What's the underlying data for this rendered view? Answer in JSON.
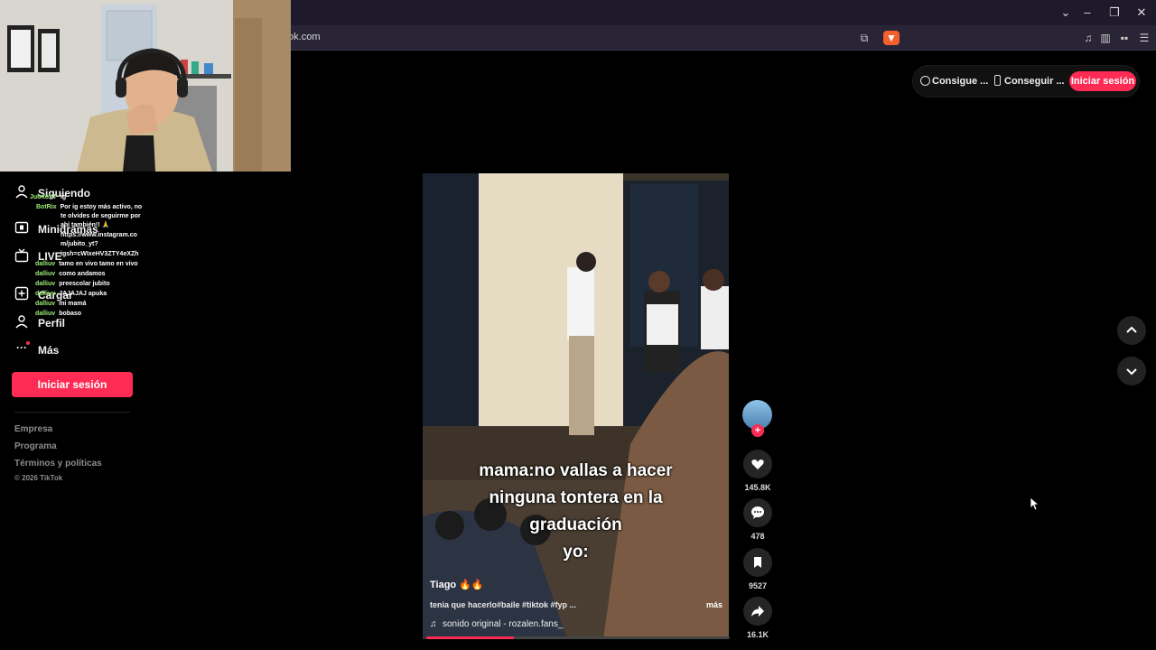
{
  "browser": {
    "url": "tok.com"
  },
  "top_actions": {
    "coins_label": "Consigue ...",
    "app_label": "Conseguir ...",
    "login_label": "Iniciar sesión"
  },
  "sidebar": {
    "items": [
      {
        "label": "Siguiendo",
        "icon": "user-icon"
      },
      {
        "label": "Minidramas",
        "icon": "film-icon"
      },
      {
        "label": "LIVE",
        "icon": "tv-icon"
      },
      {
        "label": "Cargar",
        "icon": "plus-square-icon"
      },
      {
        "label": "Perfil",
        "icon": "person-icon"
      },
      {
        "label": "Más",
        "icon": "dots-icon"
      }
    ],
    "login_label": "Iniciar sesión",
    "footer": {
      "company": "Empresa",
      "program": "Programa",
      "terms": "Términos y políticas",
      "copyright": "© 2026 TikTok"
    }
  },
  "chat": [
    {
      "user": "JubitoYT",
      "text": "ig"
    },
    {
      "user": "BotRix",
      "text": "Por ig estoy más activo, no"
    },
    {
      "user": "",
      "text": "te olvides de seguirme por"
    },
    {
      "user": "",
      "text": "ahí también!! 🙏"
    },
    {
      "user": "",
      "text": "https://www.instagram.co"
    },
    {
      "user": "",
      "text": "m/jubito_yt?"
    },
    {
      "user": "",
      "text": "igsh=cWIxeHV3ZTY4eXZh"
    },
    {
      "user": "dalliuv",
      "text": "tamo en vivo tamo en vivo"
    },
    {
      "user": "dalliuv",
      "text": "como andamos"
    },
    {
      "user": "dalliuv",
      "text": "preescolar jubito"
    },
    {
      "user": "dalliuv",
      "text": "JAJAJAJ apuka"
    },
    {
      "user": "dalliuv",
      "text": "mi mamá"
    },
    {
      "user": "dalliuv",
      "text": "bobaso"
    }
  ],
  "video": {
    "caption_lines": [
      "mama:no vallas a hacer",
      "ninguna tontera en la",
      "graduación",
      "yo:"
    ],
    "author": "Tiago 🔥🔥",
    "description": "tenia que hacerlo#baile #tiktok #fyp ...",
    "more_label": "más",
    "music": "sonido original - rozalen.fans_",
    "progress": 0.29
  },
  "actions": {
    "likes": "145.8K",
    "comments": "478",
    "saves": "9527",
    "shares": "16.1K"
  },
  "colors": {
    "accent": "#fe2c55",
    "chat_user": "#9ef07a"
  }
}
